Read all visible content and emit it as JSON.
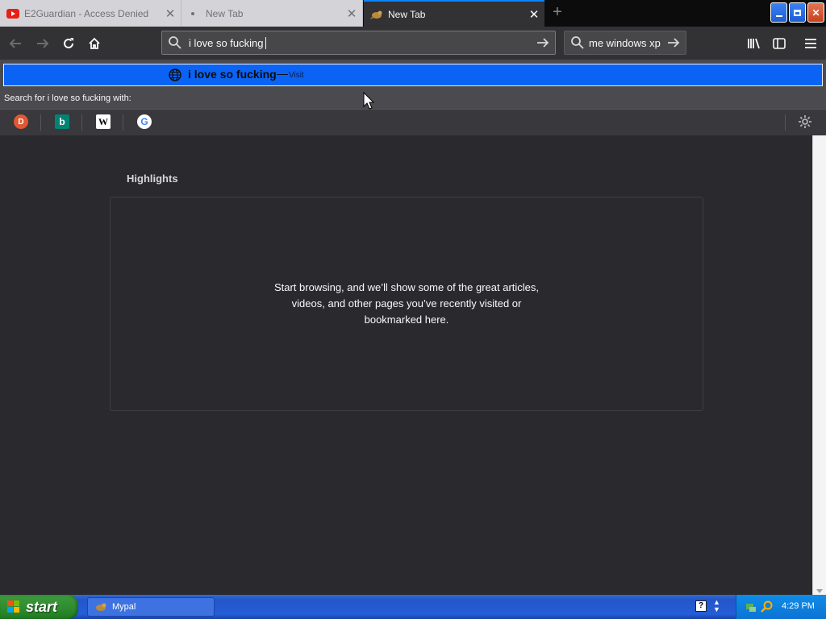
{
  "tabs": [
    {
      "title": "E2Guardian - Access Denied",
      "favicon": "youtube-icon",
      "active": false
    },
    {
      "title": "New Tab",
      "favicon": "dot-icon",
      "active": false
    },
    {
      "title": "New Tab",
      "favicon": "mypal-icon",
      "active": true
    }
  ],
  "urlbar": {
    "value": "i love so fucking "
  },
  "searchbar": {
    "value": "me windows xp"
  },
  "popup": {
    "row_title": "i love so fucking",
    "row_sep": "—",
    "row_action": "Visit",
    "search_with_label": "Search for i love so fucking  with:",
    "engines": [
      "duckduckgo",
      "bing",
      "wikipedia",
      "google"
    ]
  },
  "content": {
    "highlights_title": "Highlights",
    "empty_message": "Start browsing, and we’ll show some of the great articles, videos, and other pages you’ve recently visited or bookmarked here."
  },
  "taskbar": {
    "start_label": "start",
    "task_label": "Mypal",
    "clock": "4:29 PM"
  },
  "colors": {
    "accent": "#0a84ff",
    "popup_highlight": "#0a63f5",
    "content_bg": "#2a2a2e"
  }
}
